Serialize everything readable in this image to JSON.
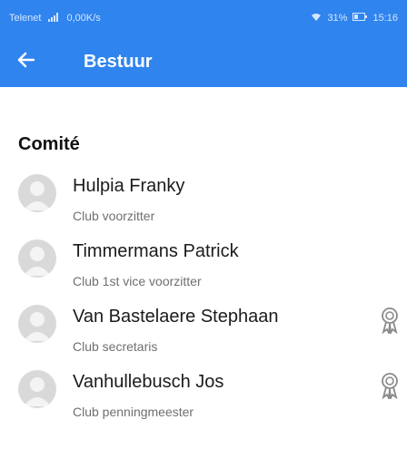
{
  "statusbar": {
    "carrier": "Telenet",
    "speed": "0,00K/s",
    "battery": "31%",
    "time": "15:16"
  },
  "appbar": {
    "back_icon": "arrow-left-icon",
    "title": "Bestuur"
  },
  "section": {
    "title": "Comité"
  },
  "members": [
    {
      "name": "Hulpia Franky",
      "role": "Club voorzitter",
      "badge": false
    },
    {
      "name": "Timmermans Patrick",
      "role": "Club 1st vice voorzitter",
      "badge": false
    },
    {
      "name": "Van Bastelaere Stephaan",
      "role": "Club secretaris",
      "badge": true
    },
    {
      "name": "Vanhullebusch Jos",
      "role": "Club penningmeester",
      "badge": true
    }
  ],
  "colors": {
    "primary": "#2f84ee",
    "avatar": "#d9d9d9",
    "badge": "#8a8a8a"
  }
}
